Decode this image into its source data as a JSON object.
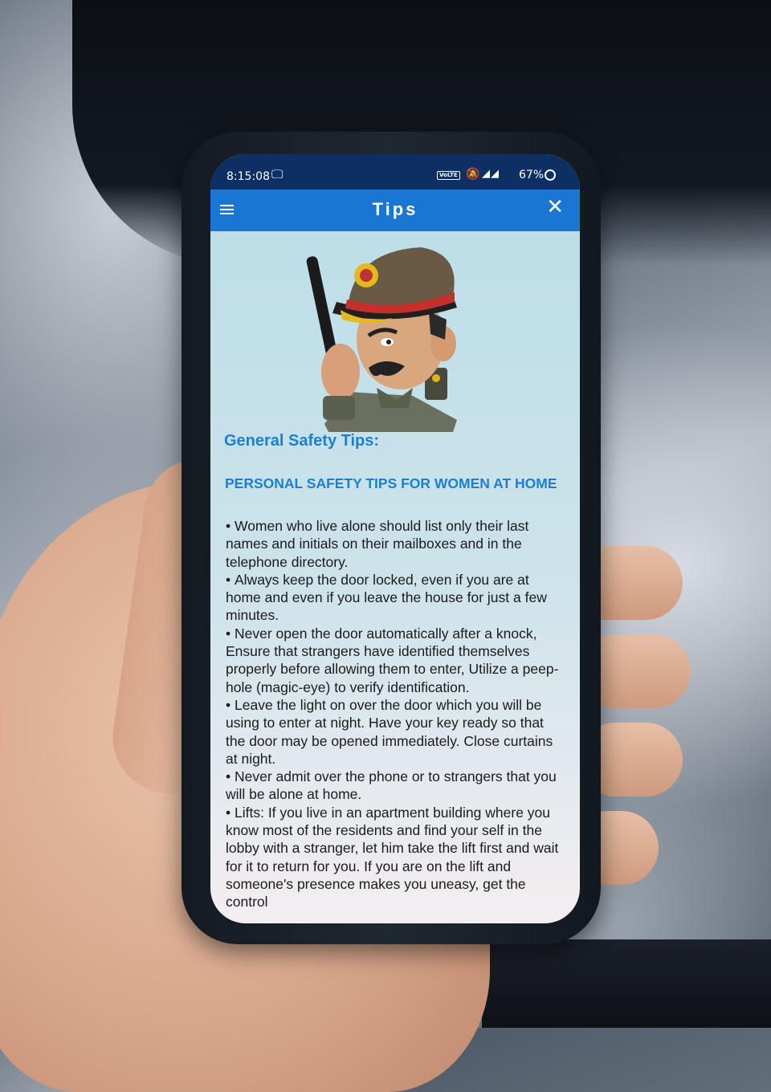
{
  "status_bar": {
    "time": "8:15:08",
    "network_badge": "VoLTE",
    "battery": "67%"
  },
  "app_bar": {
    "title": "Tips"
  },
  "content": {
    "heading": "General Safety Tips:",
    "section_title": "PERSONAL SAFETY TIPS FOR WOMEN AT HOME",
    "tips": [
      "Women who live alone should list only their last names and initials on their mailboxes and in the telephone directory.",
      "Always keep the door locked, even if you are at home and even if you leave the house for just a few minutes.",
      "Never open the door automatically after a knock, Ensure that strangers have identified themselves properly before allowing them to enter, Utilize a peep-hole (magic-eye) to verify identification.",
      "Leave the light on over the door which you will be using to enter at night. Have your key ready so that the door may be opened immediately. Close curtains at night.",
      "Never admit over the phone or to strangers that you will be alone at home.",
      "Lifts: If you live in an apartment building where you know most of the residents and find your self in the lobby with a stranger, let him take the lift first and wait for it to return for you. If you are on the lift and someone's presence makes you uneasy, get the control"
    ]
  },
  "icons": {
    "menu": "hamburger-menu-icon",
    "close": "close-icon",
    "laptop": "laptop-icon",
    "mute": "bell-off-icon",
    "signal": "signal-icon",
    "sync": "sync-icon"
  },
  "colors": {
    "app_bar": "#1976d2",
    "status_bar": "#0d2f63",
    "heading": "#1e7fd2",
    "body_text": "#1b1b1b"
  }
}
